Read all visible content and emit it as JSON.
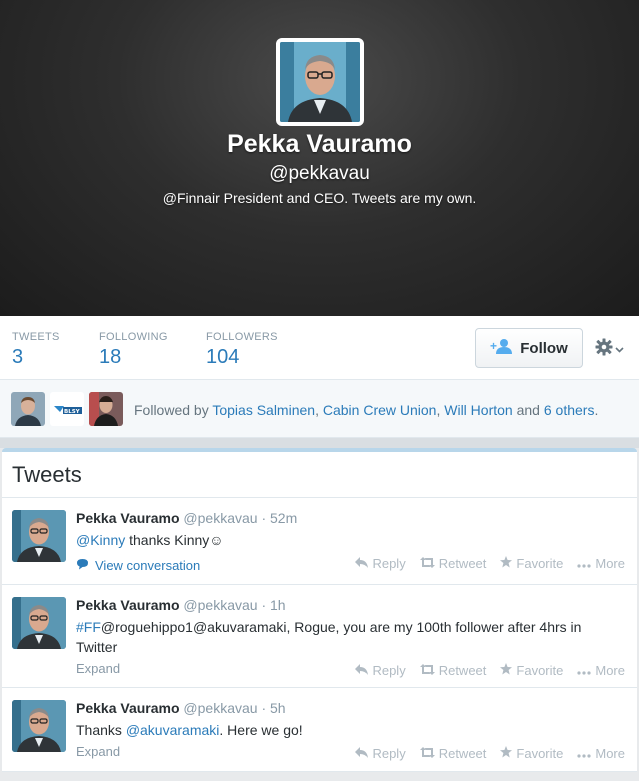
{
  "profile": {
    "name": "Pekka Vauramo",
    "handle": "@pekkavau",
    "bio": "@Finnair President and CEO. Tweets are my own."
  },
  "stats": [
    {
      "label": "TWEETS",
      "value": "3"
    },
    {
      "label": "FOLLOWING",
      "value": "18"
    },
    {
      "label": "FOLLOWERS",
      "value": "104"
    }
  ],
  "follow_label": "Follow",
  "followed_by": {
    "prefix": "Followed by",
    "names": [
      "Topias Salminen",
      "Cabin Crew Union",
      "Will Horton"
    ],
    "and": "and",
    "others": "6 others",
    "period": ".",
    "logo_text": "BLSY"
  },
  "tweets_title": "Tweets",
  "actions": {
    "reply": "Reply",
    "retweet": "Retweet",
    "favorite": "Favorite",
    "more": "More"
  },
  "tweets": [
    {
      "name": "Pekka Vauramo",
      "handle": "@pekkavau",
      "time": "52m",
      "mention": "@Kinny",
      "text": " thanks Kinny",
      "emoji": "☺",
      "link": "View conversation"
    },
    {
      "name": "Pekka Vauramo",
      "handle": "@pekkavau",
      "time": "1h",
      "hashtag": "#FF",
      "text": "@roguehippo1@akuvaramaki, Rogue, you are my 100th follower after 4hrs in Twitter",
      "link": "Expand"
    },
    {
      "name": "Pekka Vauramo",
      "handle": "@pekkavau",
      "time": "5h",
      "prefix": "Thanks ",
      "mention": "@akuvaramaki",
      "text": ". Here we go!",
      "link": "Expand"
    }
  ],
  "colors": {
    "link": "#2b7bb9",
    "muted": "#8899a6",
    "action": "#b1bbc3"
  }
}
